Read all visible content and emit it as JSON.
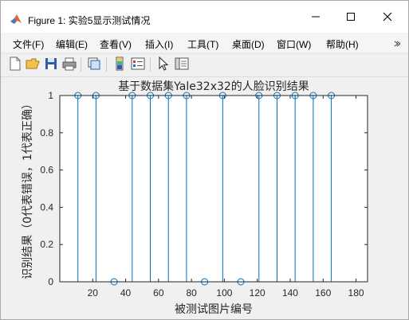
{
  "window": {
    "title": "Figure 1: 实验5显示测试情况"
  },
  "menu": [
    "文件(F)",
    "编辑(E)",
    "查看(V)",
    "插入(I)",
    "工具(T)",
    "桌面(D)",
    "窗口(W)",
    "帮助(H)"
  ],
  "colors": {
    "stem": "#0072bd",
    "axes": "#262626",
    "figure_bg": "#f0f0f0",
    "plot_bg": "#ffffff"
  },
  "chart_data": {
    "type": "stem",
    "title": "基于数据集Yale32x32的人脸识别结果",
    "xlabel": "被测试图片编号",
    "ylabel": "识别结果（0代表错误，1代表正确）",
    "xlim": [
      0,
      187
    ],
    "ylim": [
      0,
      1
    ],
    "xticks": [
      20,
      40,
      60,
      80,
      100,
      120,
      140,
      160,
      180
    ],
    "yticks": [
      0,
      0.2,
      0.4,
      0.6,
      0.8,
      1
    ],
    "x": [
      11,
      22,
      33,
      44,
      55,
      66,
      77,
      88,
      99,
      110,
      121,
      132,
      143,
      154,
      165
    ],
    "y": [
      1,
      1,
      0,
      1,
      1,
      1,
      1,
      0,
      1,
      0,
      1,
      1,
      1,
      1,
      1
    ],
    "grid": false,
    "legend": "none"
  }
}
